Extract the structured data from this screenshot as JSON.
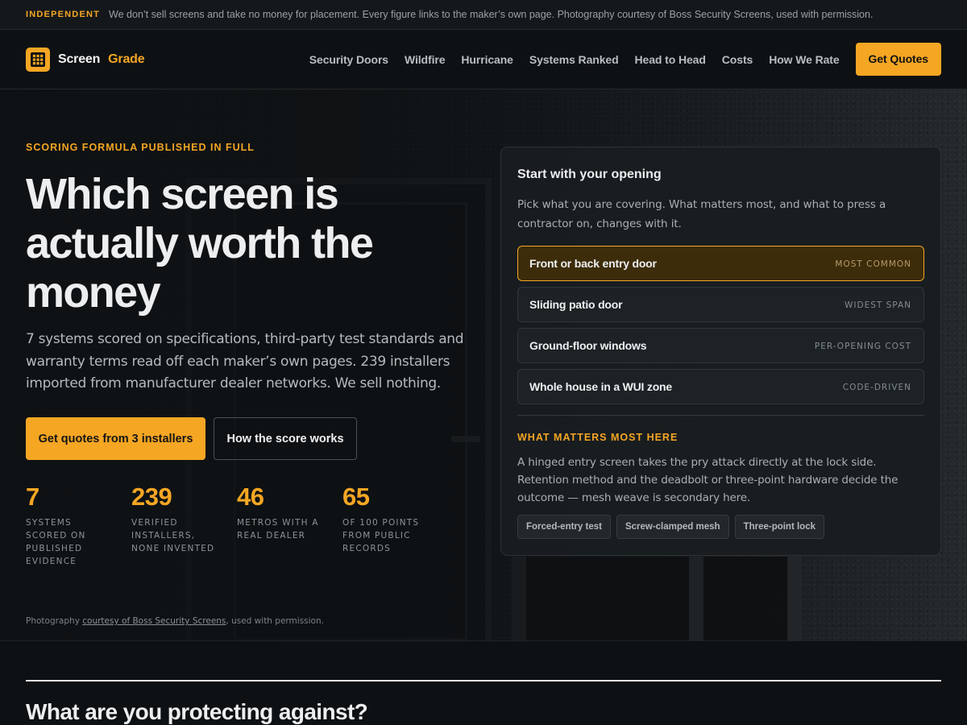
{
  "topbar": {
    "tag": "INDEPENDENT",
    "message": "We don’t sell screens and take no money for placement. Every figure links to the maker’s own page. Photography courtesy of Boss Security Screens, used with permission."
  },
  "brand": {
    "name_part1": "Screen",
    "name_part2": "Grade",
    "icon": "screen-grid-icon"
  },
  "nav": {
    "items": [
      "Security Doors",
      "Wildfire",
      "Hurricane",
      "Systems Ranked",
      "Head to Head",
      "Costs",
      "How We Rate"
    ],
    "cta": "Get Quotes"
  },
  "hero": {
    "eyebrow": "SCORING FORMULA PUBLISHED IN FULL",
    "headline": "Which screen is actually worth the money",
    "lede": "7 systems scored on specifications, third-party test standards and warranty terms read off each maker’s own pages. 239 installers imported from manufacturer dealer networks. We sell nothing.",
    "primary_button": "Get quotes from 3 installers",
    "secondary_button": "How the score works",
    "stats": [
      {
        "value": "7",
        "label": "SYSTEMS SCORED ON PUBLISHED EVIDENCE"
      },
      {
        "value": "239",
        "label": "VERIFIED INSTALLERS, NONE INVENTED"
      },
      {
        "value": "46",
        "label": "METROS WITH A REAL DEALER"
      },
      {
        "value": "65",
        "label": "OF 100 POINTS FROM PUBLIC RECORDS"
      }
    ],
    "credit_prefix": "Photography ",
    "credit_link": "courtesy of Boss Security Screens",
    "credit_suffix": ", used with permission."
  },
  "opening_card": {
    "title": "Start with your opening",
    "description": "Pick what you are covering. What matters most, and what to press a contractor on, changes with it.",
    "options": [
      {
        "label": "Front or back entry door",
        "badge": "MOST COMMON",
        "selected": true
      },
      {
        "label": "Sliding patio door",
        "badge": "WIDEST SPAN",
        "selected": false
      },
      {
        "label": "Ground-floor windows",
        "badge": "PER-OPENING COST",
        "selected": false
      },
      {
        "label": "Whole house in a WUI zone",
        "badge": "CODE-DRIVEN",
        "selected": false
      }
    ],
    "matters_title": "WHAT MATTERS MOST HERE",
    "matters_body": "A hinged entry screen takes the pry attack directly at the lock side. Retention method and the deadbolt or three-point hardware decide the outcome — mesh weave is secondary here.",
    "chips": [
      "Forced-entry test",
      "Screw-clamped mesh",
      "Three-point lock"
    ]
  },
  "section2": {
    "title": "What are you protecting against?"
  },
  "colors": {
    "accent": "#f5a623",
    "background": "#0e1113",
    "card": "#191d20"
  }
}
